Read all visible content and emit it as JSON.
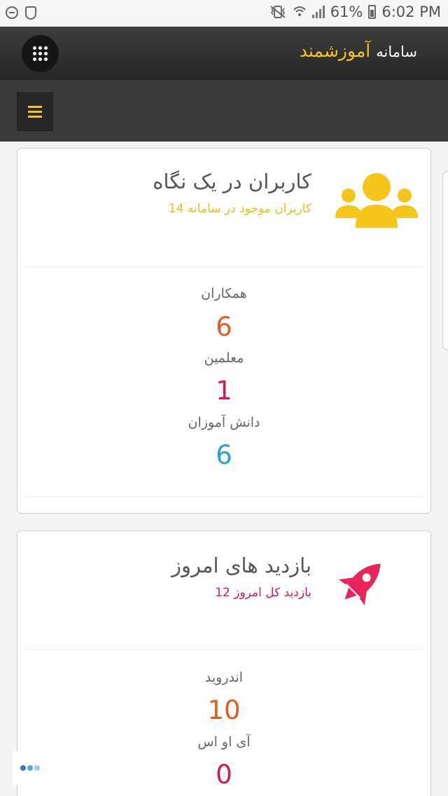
{
  "status_bar": {
    "battery": "61%",
    "time": "6:02 PM"
  },
  "header": {
    "title_part1": "سامانه",
    "title_part2": "آموزشمند"
  },
  "colors": {
    "accent": "#f6c51b",
    "orange": "#e55a2a",
    "crimson": "#cc1e4f",
    "blue": "#2b9ed6"
  },
  "icons": {
    "menu": "apps-grid-icon",
    "hamburger": "hamburger-menu-icon",
    "card1": "users-group-icon",
    "card2": "rocket-icon",
    "loader": "loading-dots-icon"
  },
  "users_card": {
    "title": "کاربران در یک نگاه",
    "subtitle": "کاربران موجود در سامانه 14",
    "stats": [
      {
        "label": "همکاران",
        "value": "6"
      },
      {
        "label": "معلمین",
        "value": "1"
      },
      {
        "label": "دانش آموزان",
        "value": "6"
      }
    ]
  },
  "visits_card": {
    "title": "بازدید های امروز",
    "subtitle": "بازدید کل امروز 12",
    "stats": [
      {
        "label": "اندروید",
        "value": "10"
      },
      {
        "label": "آی او اس",
        "value": "0"
      }
    ]
  }
}
